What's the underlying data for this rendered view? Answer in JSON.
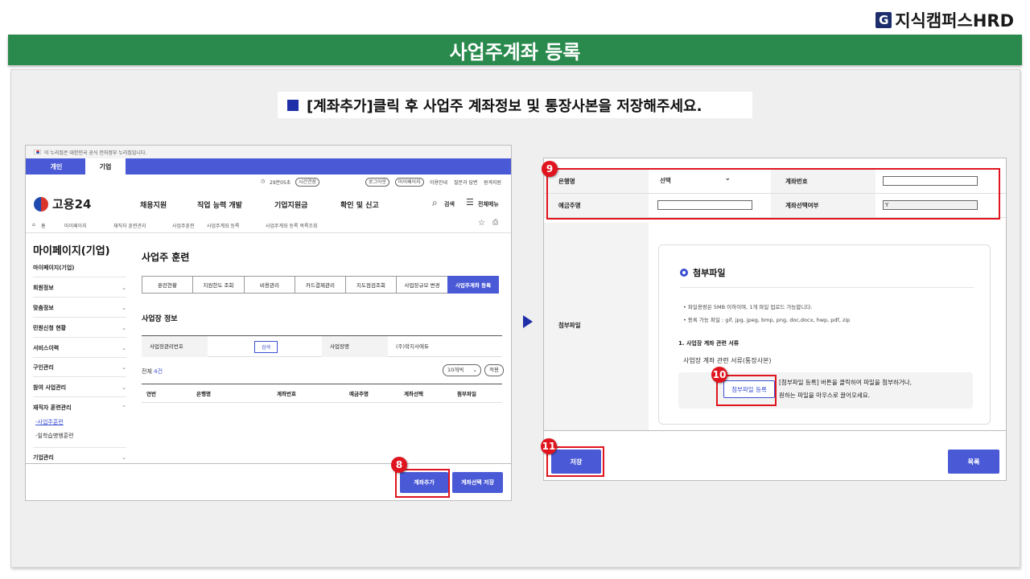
{
  "brand": {
    "mark": "G",
    "name": "지식캠퍼스HRD"
  },
  "title": "사업주계좌 등록",
  "instruction": "[계좌추가]클릭 후 사업주 계좌정보 및 통장사본을 저장해주세요.",
  "left": {
    "gov_banner": "이 누리집은 대한민국 공식 전자정부 누리집입니다.",
    "tabs": [
      "개인",
      "기업"
    ],
    "util": {
      "time": "29분05초",
      "extend": "시간연장",
      "logout": "로그아웃",
      "mypage": "마이페이지",
      "guide": "이용안내",
      "qna": "질문과 답변",
      "remote": "원격지원"
    },
    "logo": "고용24",
    "gnb": [
      "채용지원",
      "직업 능력 개발",
      "기업지원금",
      "확인 및 신고"
    ],
    "search": "검색",
    "menu": "전체메뉴",
    "breadcrumb": [
      "홈",
      "마이페이지",
      "재직자 훈련관리",
      "사업주훈련",
      "사업주계좌 등록",
      "사업주계좌 등록 목록조회"
    ],
    "sidebar": {
      "title": "마이페이지(기업)",
      "items": [
        "마이페이지(기업)",
        "회원정보",
        "맞춤정보",
        "민원신청 현황",
        "서비스이력",
        "구인관리",
        "참여 사업관리",
        "재직자 훈련관리",
        "기업관리"
      ],
      "subitems": [
        "사업주훈련",
        "일학습병행훈련"
      ]
    },
    "main_title": "사업주 훈련",
    "subtabs": [
      "훈련현황",
      "지원한도 조회",
      "비용관리",
      "카드결제관리",
      "지도점검조회",
      "사업장규모 변경",
      "사업주계좌 등록"
    ],
    "section_title": "사업장 정보",
    "info": {
      "label1": "사업장관리번호",
      "search": "검색",
      "label2": "사업장명",
      "value2": "(주)학지사에듀"
    },
    "count_prefix": "전체",
    "count_value": "4건",
    "page_size": "10개씩",
    "apply": "적용",
    "columns": [
      "연번",
      "은행명",
      "계좌번호",
      "예금주명",
      "계좌선택",
      "첨부파일"
    ],
    "add_account": "계좌추가",
    "save_selected": "계좌선택 저장"
  },
  "markers": [
    "8",
    "9",
    "10",
    "11"
  ],
  "right": {
    "bank_label": "은행명",
    "bank_value": "선택",
    "account_label": "계좌번호",
    "account_value": "",
    "holder_label": "예금주명",
    "holder_value": "",
    "selected_label": "계좌선택여부",
    "selected_value": "Y",
    "attach_label": "첨부파일",
    "attach_title": "첨부파일",
    "notes": [
      "파일용량은 5MB 이하이며, 1개 파일 업로드 가능합니다.",
      "등록 가능 파일 : gif, jpg, jpeg, bmp, png, doc,docx, hwp, pdf, zip"
    ],
    "doc_heading": "1. 사업장 계좌 관련 서류",
    "doc_sub": "사업장 계좌 관련 서류(통장사본)",
    "register_button": "첨부파일 등록",
    "drop_line1": "[첨부파일 등록] 버튼을 클릭하여 파일을 첨부하거나,",
    "drop_line2": "원하는 파일을 마우스로 끌어오세요.",
    "save": "저장",
    "list": "목록"
  }
}
